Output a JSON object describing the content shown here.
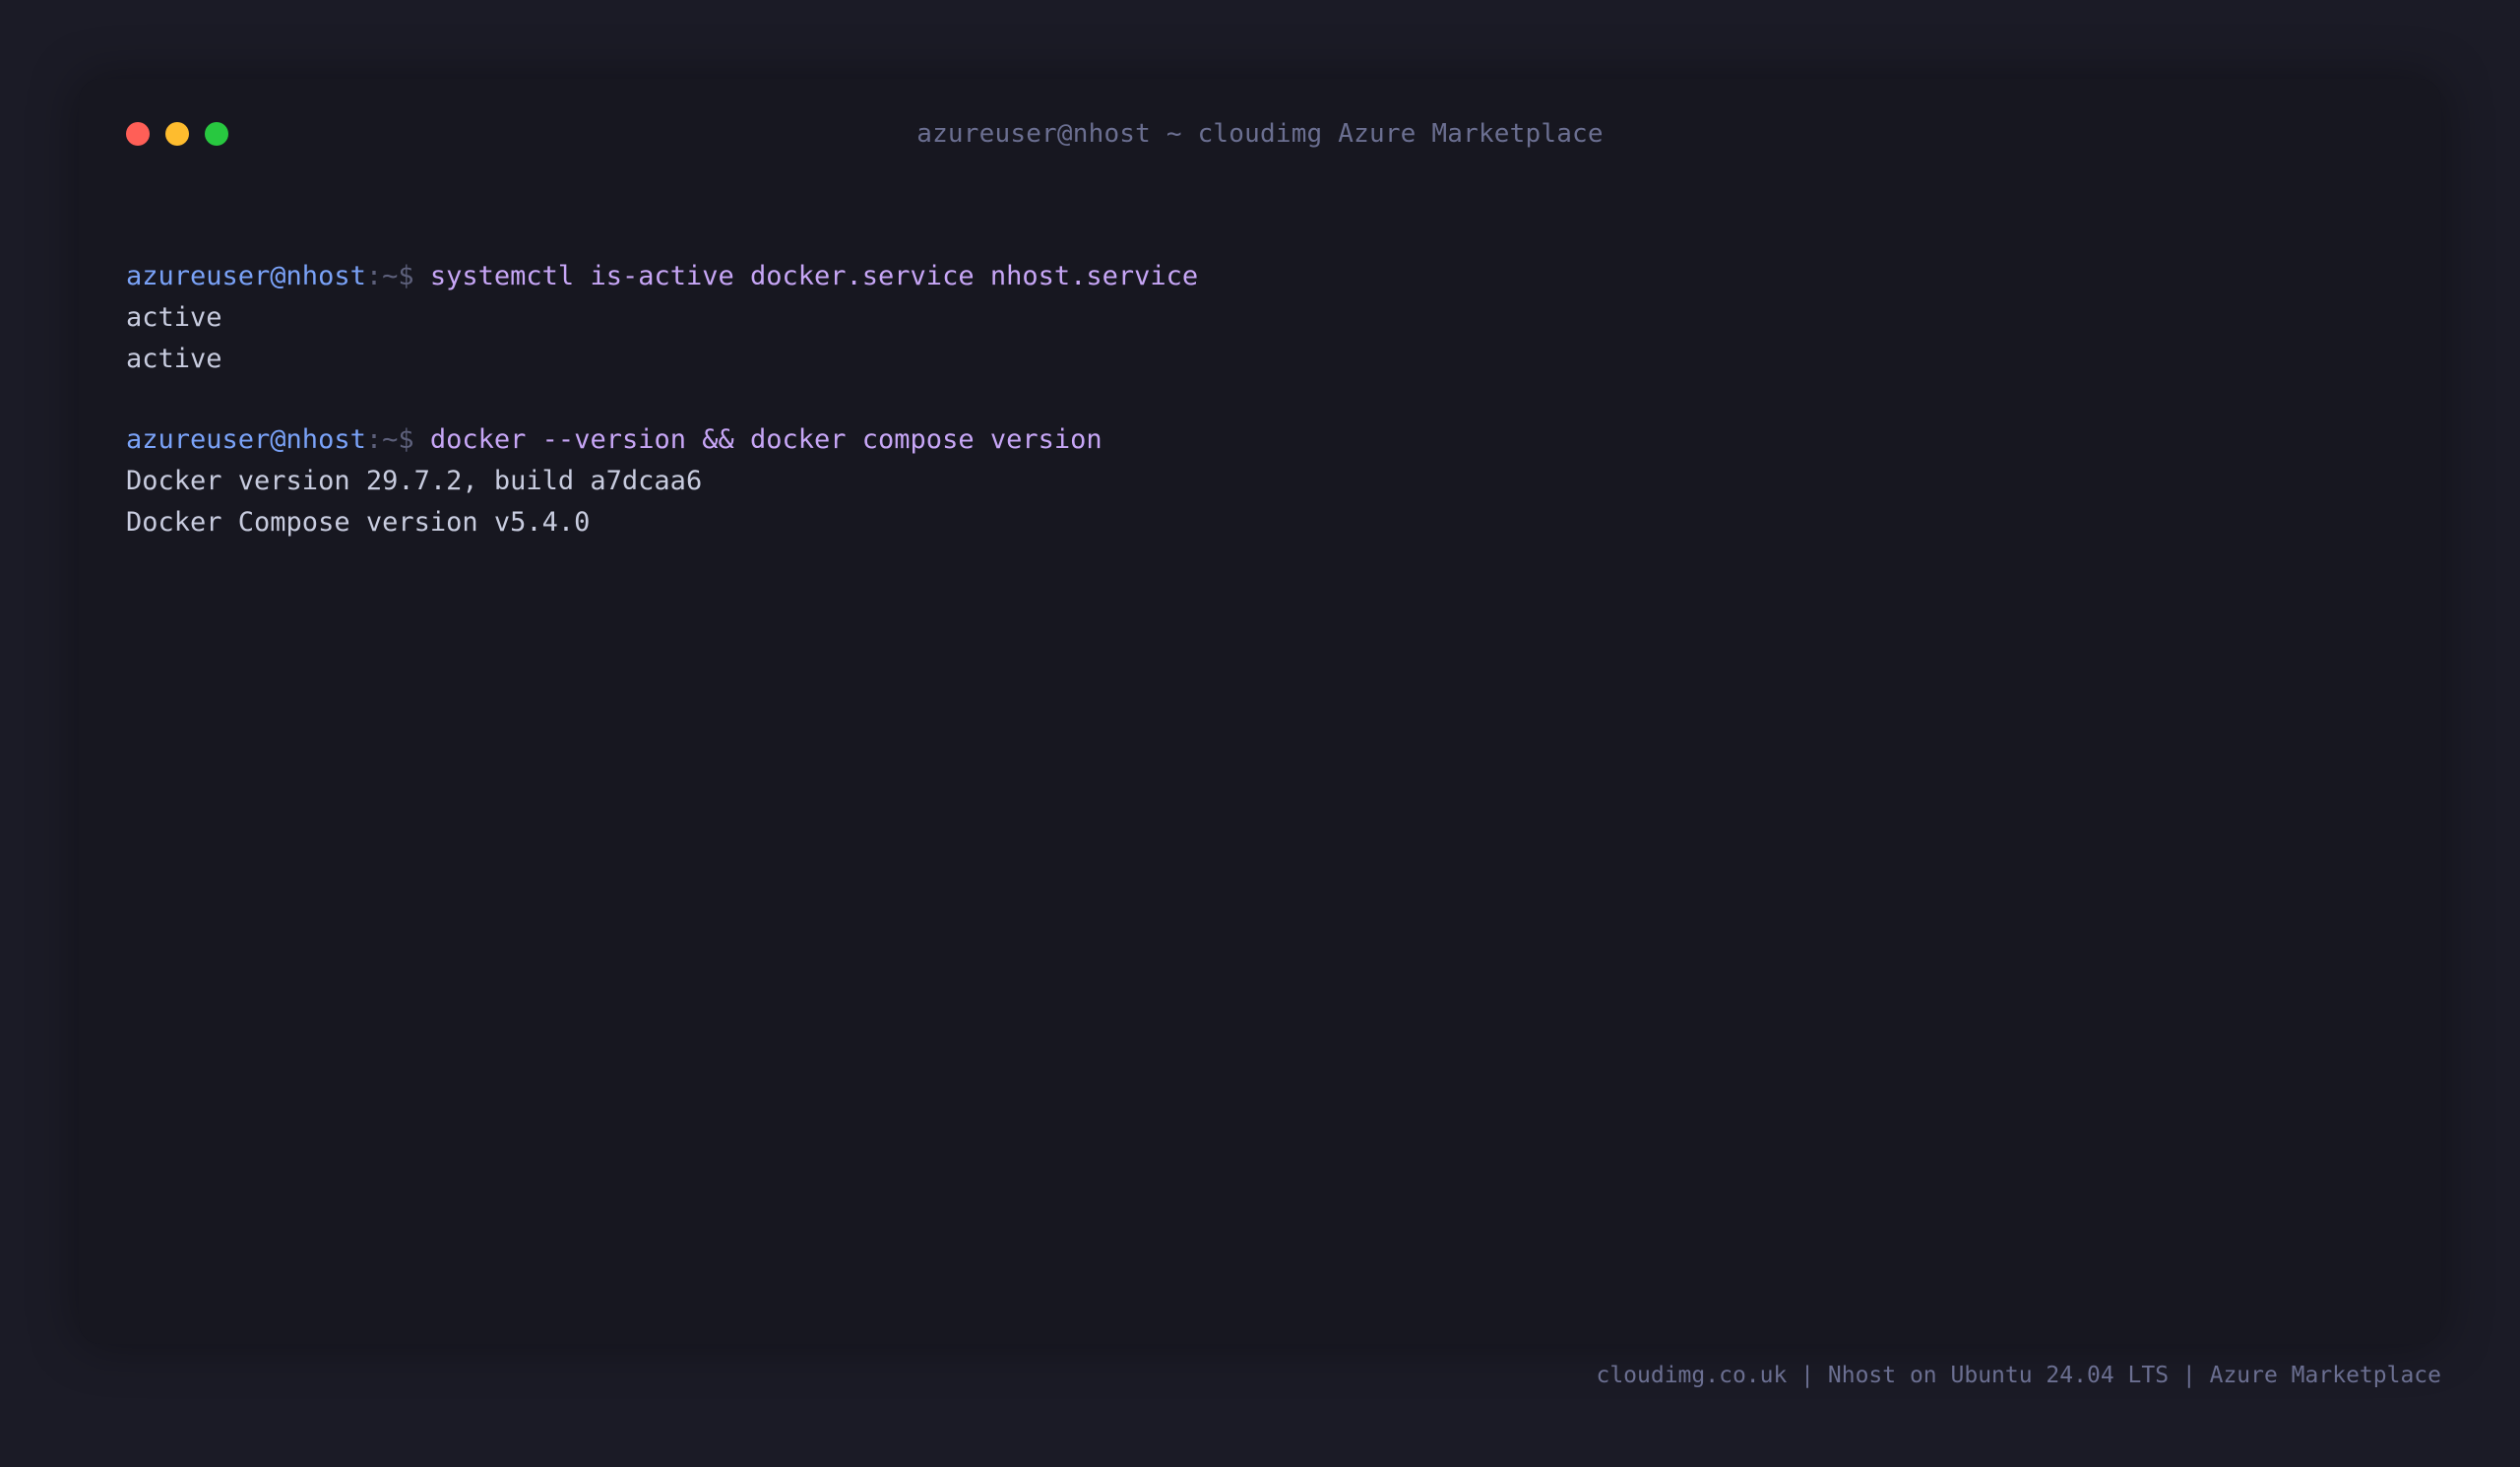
{
  "window": {
    "title": "azureuser@nhost ~ cloudimg Azure Marketplace"
  },
  "session": {
    "blocks": [
      {
        "prompt_user": "azureuser@nhost",
        "prompt_path": ":~$",
        "command": "systemctl is-active docker.service nhost.service",
        "output": [
          "active",
          "active"
        ]
      },
      {
        "prompt_user": "azureuser@nhost",
        "prompt_path": ":~$",
        "command": "docker --version && docker compose version",
        "output": [
          "Docker version 29.7.2, build a7dcaa6",
          "Docker Compose version v5.4.0"
        ]
      }
    ]
  },
  "footer": {
    "text": "cloudimg.co.uk | Nhost on Ubuntu 24.04 LTS | Azure Marketplace"
  },
  "colors": {
    "background": "#1b1b26",
    "terminal": "#171720",
    "prompt_user": "#7aa2f7",
    "prompt_path": "#5d607b",
    "command": "#c7a6f6",
    "output": "#c8ccdf",
    "muted": "#6b6f91",
    "close": "#ff5f57",
    "minimize": "#febc2e",
    "maximize": "#28c840"
  }
}
